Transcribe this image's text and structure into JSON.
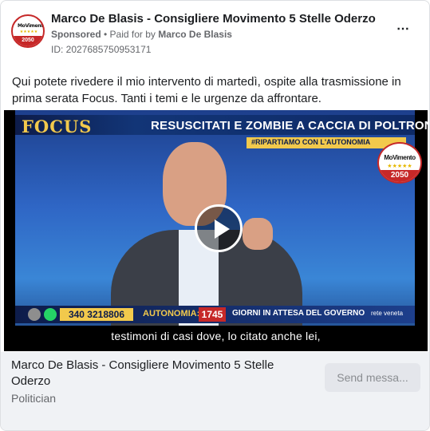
{
  "post": {
    "page_name": "Marco De Blasis - Consigliere Movimento 5 Stelle Oderzo",
    "sponsored_label": "Sponsored",
    "paid_for_label": " • Paid for by ",
    "payer_name": "Marco De Blasis",
    "ad_id": "ID: 2027685750953171",
    "more_icon": "⋯",
    "body_text": "Qui potete rivedere il mio intervento di martedì, ospite alla trasmissione in prima serata Focus. Tanti i temi e le urgenze da affrontare."
  },
  "avatar": {
    "logo_text": "MoVimento",
    "stars": "★★★★★",
    "year": "2050"
  },
  "video": {
    "show_logo": "FOCUS",
    "headline": "RESUSCITATI E ZOMBIE A CACCIA DI POLTRONE",
    "subhead": "#RIPARTIAMO CON L'AUTONOMIA",
    "badge_text": "MoVimento",
    "badge_stars": "★★★★★",
    "badge_year": "2050",
    "phone_number": "340 3218806",
    "autonomia_label": "AUTONOMIA:",
    "days_count": "1745",
    "days_label": "GIORNI IN ATTESA DEL GOVERNO",
    "network_logo": "rete veneta",
    "caption": "testimoni di casi dove, lo citato anche lei,"
  },
  "footer": {
    "title": "Marco De Blasis - Consigliere Movimento 5 Stelle Oderzo",
    "category": "Politician",
    "send_button": "Send messa..."
  }
}
